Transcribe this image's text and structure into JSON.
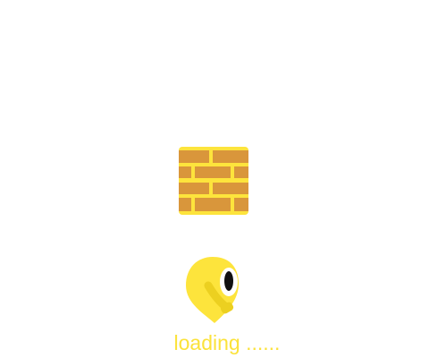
{
  "loading": {
    "text": "loading ......"
  },
  "colors": {
    "yellow": "#fde43c",
    "brick": "#d9963b",
    "dark_yellow": "#ecd020"
  }
}
